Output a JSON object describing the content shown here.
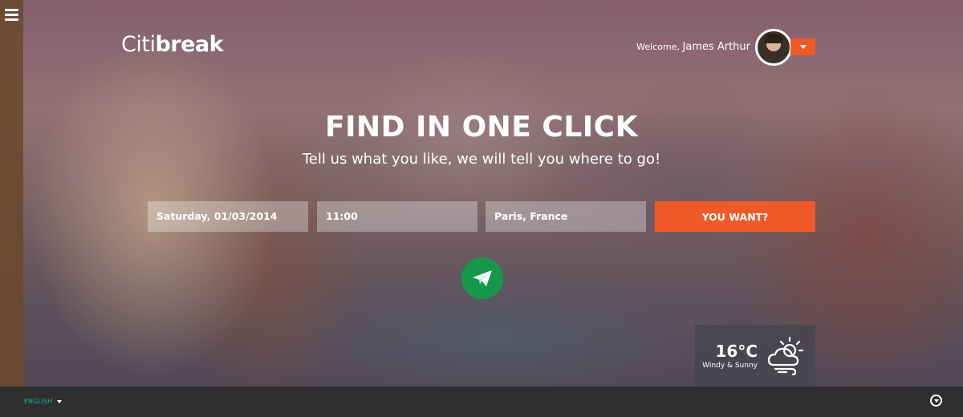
{
  "brand": {
    "logo_light": "Citi",
    "logo_bold": "break"
  },
  "user": {
    "welcome_label": "Welcome,",
    "name": "James Arthur"
  },
  "hero": {
    "title": "FIND IN ONE CLICK",
    "subtitle": "Tell us what you like, we will tell you where to go!"
  },
  "search": {
    "date_value": "Saturday, 01/03/2014",
    "time_value": "11:00",
    "location_value": "Paris, France",
    "submit_label": "YOU WANT?"
  },
  "weather": {
    "temperature": "16°C",
    "condition": "Windy & Sunny"
  },
  "footer": {
    "language": "ENGLISH"
  },
  "colors": {
    "accent": "#f05a28",
    "send": "#16984c",
    "language_text": "#1fae9a",
    "footer_bg": "#2f2f2f"
  },
  "icons": [
    "menu-icon",
    "caret-down-icon",
    "paper-plane-icon",
    "partly-cloudy-windy-icon",
    "scroll-down-icon"
  ]
}
